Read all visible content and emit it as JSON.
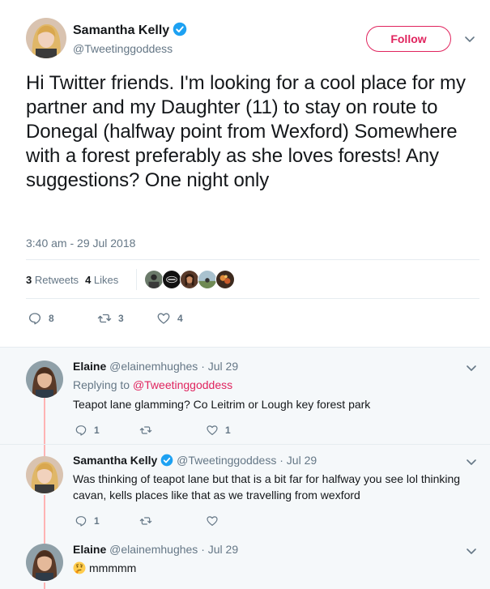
{
  "main_tweet": {
    "author_name": "Samantha Kelly",
    "author_handle": "@Tweetinggoddess",
    "follow_label": "Follow",
    "text": "Hi Twitter friends. I'm looking for a cool place for my partner and my Daughter (11) to stay on route to Donegal (halfway point from Wexford) Somewhere with a forest preferably as she loves forests! Any suggestions? One night only",
    "timestamp": "3:40 am - 29 Jul 2018",
    "retweets_count": "3",
    "retweets_label": "Retweets",
    "likes_count": "4",
    "likes_label": "Likes",
    "reply_count": "8",
    "retweet_action_count": "3",
    "like_action_count": "4"
  },
  "replies": [
    {
      "name": "Elaine",
      "handle": "@elainemhughes",
      "date": "· Jul 29",
      "replying_prefix": "Replying to",
      "replying_to": "@Tweetinggoddess",
      "text": "Teapot lane glamming? Co Leitrim or Lough key forest park",
      "reply_count": "1",
      "retweet_count": "",
      "like_count": "1"
    },
    {
      "name": "Samantha Kelly",
      "handle": "@Tweetinggoddess",
      "date": "· Jul 29",
      "text": "Was thinking of teapot lane but that is a bit far for halfway you see lol thinking cavan, kells places like that as we travelling from wexford",
      "reply_count": "1",
      "retweet_count": "",
      "like_count": ""
    },
    {
      "name": "Elaine",
      "handle": "@elainemhughes",
      "date": "· Jul 29",
      "text": "mmmmm",
      "emoji": "thinking-face"
    }
  ],
  "icons": {
    "verified": "verified-badge-icon",
    "chevron": "chevron-down-icon",
    "reply": "reply-icon",
    "retweet": "retweet-icon",
    "like": "heart-icon"
  },
  "colors": {
    "accent": "#e0245e",
    "verified": "#1da1f2",
    "muted": "#657786",
    "thread_line": "#ffb3b3",
    "reply_bg": "#f5f8fa"
  }
}
